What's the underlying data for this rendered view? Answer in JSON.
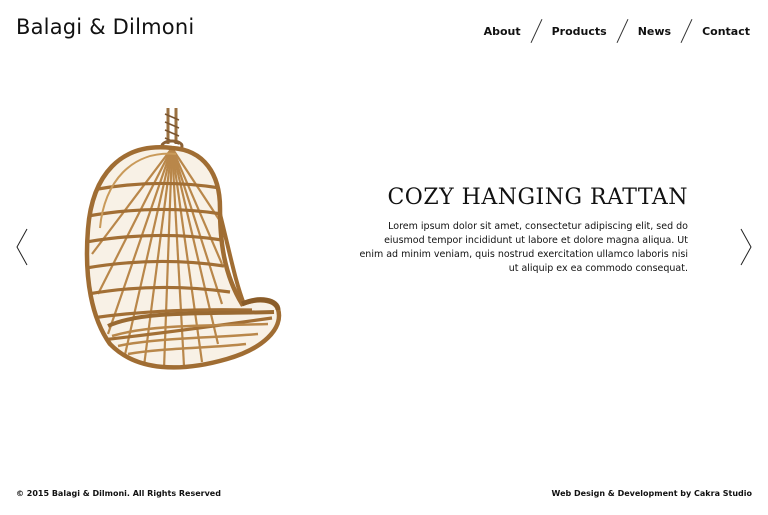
{
  "header": {
    "brand": "Balagi & Dilmoni",
    "nav": {
      "about": "About",
      "products": "Products",
      "news": "News",
      "contact": "Contact"
    }
  },
  "slide": {
    "title": "COZY HANGING RATTAN",
    "description": "Lorem ipsum dolor sit amet, consectetur adipiscing elit, sed do eiusmod tempor incididunt ut labore et dolore magna aliqua. Ut enim ad minim veniam, quis nostrud exercitation ullamco laboris nisi ut aliquip ex ea commodo consequat.",
    "image_icon": "hanging-rattan-chair"
  },
  "controls": {
    "prev_icon": "chevron-left-icon",
    "next_icon": "chevron-right-icon"
  },
  "footer": {
    "copyright": "© 2015 Balagi & Dilmoni. All Rights Reserved",
    "credit": "Web Design & Development by Cakra Studio"
  },
  "colors": {
    "background": "#ffffff",
    "text": "#111111",
    "rattan": "#c8995a"
  }
}
